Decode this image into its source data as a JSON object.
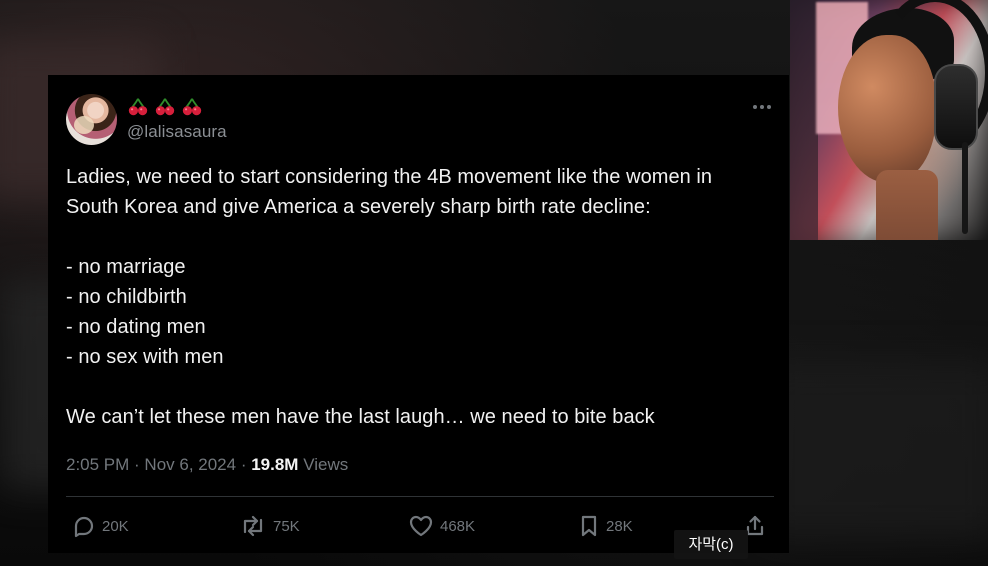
{
  "tweet": {
    "display_name_emojis": [
      "cherry",
      "cherry",
      "cherry"
    ],
    "handle": "@lalisasaura",
    "body_lines": [
      "Ladies, we need to start considering the 4B movement like the women in",
      "South Korea and give America a severely sharp birth rate decline:",
      "",
      "- no marriage",
      "- no childbirth",
      "- no dating men",
      "- no sex with men",
      "",
      "We can’t let these men have the last laugh… we need to bite back"
    ],
    "time": "2:05 PM",
    "separator": " · ",
    "date": "Nov 6, 2024",
    "views_count": "19.8M",
    "views_label": "Views"
  },
  "actions": {
    "reply_count": "20K",
    "repost_count": "75K",
    "like_count": "468K",
    "bookmark_count": "28K"
  },
  "overlay": {
    "subtitle_label": "자막(c)"
  },
  "icons": {
    "more": "more-icon",
    "reply": "reply-icon",
    "repost": "repost-icon",
    "like": "heart-icon",
    "bookmark": "bookmark-icon",
    "share": "share-icon",
    "emoji": "cherry-icon"
  },
  "colors": {
    "card_bg": "#000000",
    "text_primary": "#e7e9ea",
    "text_secondary": "#72777c",
    "divider": "#2f3336",
    "cherry_red": "#d61f3b",
    "cherry_stem": "#2f8d2b"
  }
}
